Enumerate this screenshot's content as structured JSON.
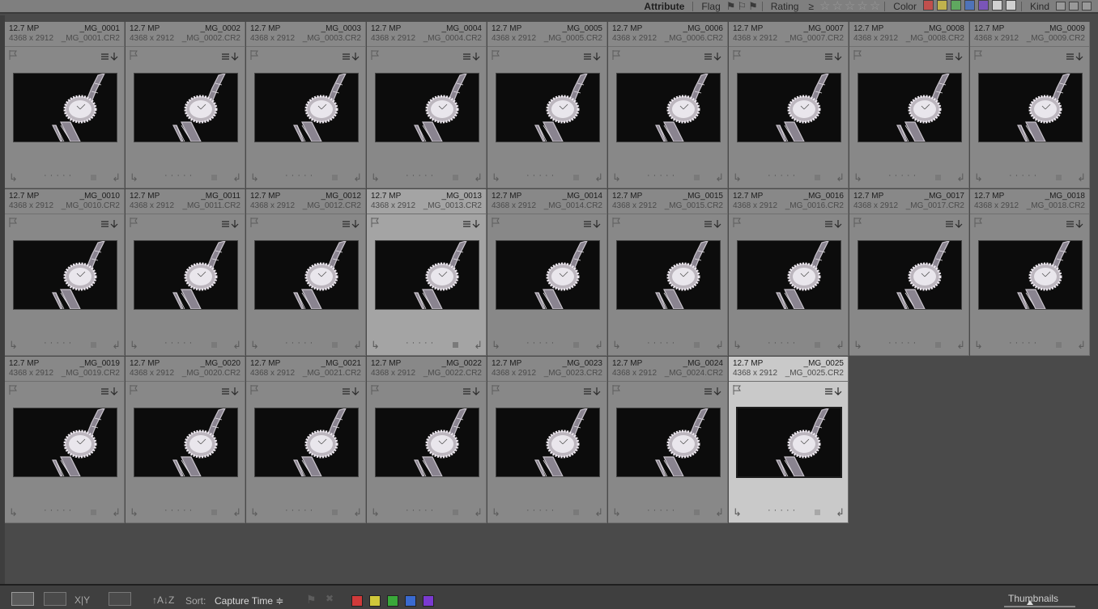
{
  "filter_bar": {
    "attribute_label": "Attribute",
    "flag_label": "Flag",
    "rating_label": "Rating",
    "rating_op": "≥",
    "stars": [
      "☆",
      "☆",
      "☆",
      "☆",
      "☆"
    ],
    "color_label": "Color",
    "colors": [
      "#c0504d",
      "#c0b24d",
      "#5fa85f",
      "#4f73b8",
      "#7a55b8",
      "#d0d0d0",
      "#d0d0d0"
    ],
    "kind_label": "Kind"
  },
  "grid": {
    "photos": [
      {
        "mp": "12.7 MP",
        "dims": "4368 x 2912",
        "name": "_MG_0001",
        "file": "_MG_0001.CR2",
        "state": "normal"
      },
      {
        "mp": "12.7 MP",
        "dims": "4368 x 2912",
        "name": "_MG_0002",
        "file": "_MG_0002.CR2",
        "state": "normal"
      },
      {
        "mp": "12.7 MP",
        "dims": "4368 x 2912",
        "name": "_MG_0003",
        "file": "_MG_0003.CR2",
        "state": "normal"
      },
      {
        "mp": "12.7 MP",
        "dims": "4368 x 2912",
        "name": "_MG_0004",
        "file": "_MG_0004.CR2",
        "state": "normal"
      },
      {
        "mp": "12.7 MP",
        "dims": "4368 x 2912",
        "name": "_MG_0005",
        "file": "_MG_0005.CR2",
        "state": "normal"
      },
      {
        "mp": "12.7 MP",
        "dims": "4368 x 2912",
        "name": "_MG_0006",
        "file": "_MG_0006.CR2",
        "state": "normal"
      },
      {
        "mp": "12.7 MP",
        "dims": "4368 x 2912",
        "name": "_MG_0007",
        "file": "_MG_0007.CR2",
        "state": "normal"
      },
      {
        "mp": "12.7 MP",
        "dims": "4368 x 2912",
        "name": "_MG_0008",
        "file": "_MG_0008.CR2",
        "state": "normal"
      },
      {
        "mp": "12.7 MP",
        "dims": "4368 x 2912",
        "name": "_MG_0009",
        "file": "_MG_0009.CR2",
        "state": "normal"
      },
      {
        "mp": "12.7 MP",
        "dims": "4368 x 2912",
        "name": "_MG_0010",
        "file": "_MG_0010.CR2",
        "state": "normal"
      },
      {
        "mp": "12.7 MP",
        "dims": "4368 x 2912",
        "name": "_MG_0011",
        "file": "_MG_0011.CR2",
        "state": "normal"
      },
      {
        "mp": "12.7 MP",
        "dims": "4368 x 2912",
        "name": "_MG_0012",
        "file": "_MG_0012.CR2",
        "state": "normal"
      },
      {
        "mp": "12.7 MP",
        "dims": "4368 x 2912",
        "name": "_MG_0013",
        "file": "_MG_0013.CR2",
        "state": "hover"
      },
      {
        "mp": "12.7 MP",
        "dims": "4368 x 2912",
        "name": "_MG_0014",
        "file": "_MG_0014.CR2",
        "state": "normal"
      },
      {
        "mp": "12.7 MP",
        "dims": "4368 x 2912",
        "name": "_MG_0015",
        "file": "_MG_0015.CR2",
        "state": "normal"
      },
      {
        "mp": "12.7 MP",
        "dims": "4368 x 2912",
        "name": "_MG_0016",
        "file": "_MG_0016.CR2",
        "state": "normal"
      },
      {
        "mp": "12.7 MP",
        "dims": "4368 x 2912",
        "name": "_MG_0017",
        "file": "_MG_0017.CR2",
        "state": "normal"
      },
      {
        "mp": "12.7 MP",
        "dims": "4368 x 2912",
        "name": "_MG_0018",
        "file": "_MG_0018.CR2",
        "state": "normal"
      },
      {
        "mp": "12.7 MP",
        "dims": "4368 x 2912",
        "name": "_MG_0019",
        "file": "_MG_0019.CR2",
        "state": "normal"
      },
      {
        "mp": "12.7 MP",
        "dims": "4368 x 2912",
        "name": "_MG_0020",
        "file": "_MG_0020.CR2",
        "state": "normal"
      },
      {
        "mp": "12.7 MP",
        "dims": "4368 x 2912",
        "name": "_MG_0021",
        "file": "_MG_0021.CR2",
        "state": "normal"
      },
      {
        "mp": "12.7 MP",
        "dims": "4368 x 2912",
        "name": "_MG_0022",
        "file": "_MG_0022.CR2",
        "state": "normal"
      },
      {
        "mp": "12.7 MP",
        "dims": "4368 x 2912",
        "name": "_MG_0023",
        "file": "_MG_0023.CR2",
        "state": "normal"
      },
      {
        "mp": "12.7 MP",
        "dims": "4368 x 2912",
        "name": "_MG_0024",
        "file": "_MG_0024.CR2",
        "state": "normal"
      },
      {
        "mp": "12.7 MP",
        "dims": "4368 x 2912",
        "name": "_MG_0025",
        "file": "_MG_0025.CR2",
        "state": "selected"
      }
    ]
  },
  "toolbar": {
    "sort_label": "Sort:",
    "sort_value": "Capture Time",
    "sort_arrows": "≑",
    "az_glyph": "↑A↓Z",
    "xy_label": "X|Y",
    "label_colors": [
      "#d03a3a",
      "#d0c83a",
      "#3aa83a",
      "#3a6ad0",
      "#7a3ad0"
    ],
    "thumbnails_label": "Thumbnails"
  }
}
